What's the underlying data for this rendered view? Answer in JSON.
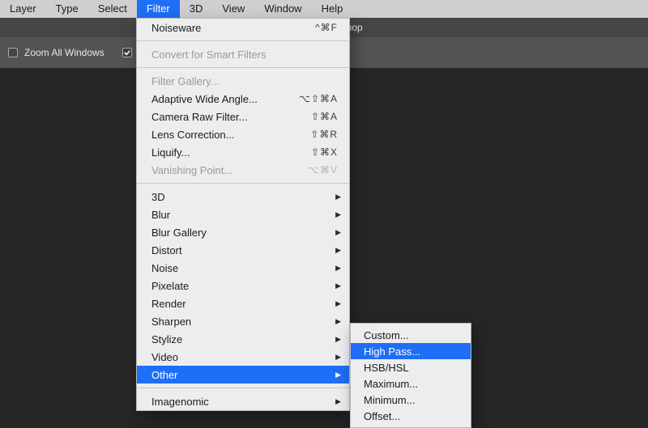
{
  "menubar": {
    "items": [
      "Layer",
      "Type",
      "Select",
      "Filter",
      "3D",
      "View",
      "Window",
      "Help"
    ],
    "activeIndex": 3
  },
  "appTitle": "Adobe Photoshop",
  "optionsBar": {
    "zoomAll": {
      "label": "Zoom All Windows",
      "checked": false
    },
    "scrubby": {
      "label": "Scrubby Zoom",
      "checked": true,
      "visibleLabel": "Scrubb"
    }
  },
  "filterMenu": {
    "groups": [
      [
        {
          "label": "Noiseware",
          "shortcut": "^⌘F",
          "disabled": false
        }
      ],
      [
        {
          "label": "Convert for Smart Filters",
          "shortcut": "",
          "disabled": true
        }
      ],
      [
        {
          "label": "Filter Gallery...",
          "shortcut": "",
          "disabled": true
        },
        {
          "label": "Adaptive Wide Angle...",
          "shortcut": "⌥⇧⌘A",
          "disabled": false
        },
        {
          "label": "Camera Raw Filter...",
          "shortcut": "⇧⌘A",
          "disabled": false
        },
        {
          "label": "Lens Correction...",
          "shortcut": "⇧⌘R",
          "disabled": false
        },
        {
          "label": "Liquify...",
          "shortcut": "⇧⌘X",
          "disabled": false
        },
        {
          "label": "Vanishing Point...",
          "shortcut": "⌥⌘V",
          "disabled": true
        }
      ],
      [
        {
          "label": "3D",
          "submenu": true
        },
        {
          "label": "Blur",
          "submenu": true
        },
        {
          "label": "Blur Gallery",
          "submenu": true
        },
        {
          "label": "Distort",
          "submenu": true
        },
        {
          "label": "Noise",
          "submenu": true
        },
        {
          "label": "Pixelate",
          "submenu": true
        },
        {
          "label": "Render",
          "submenu": true
        },
        {
          "label": "Sharpen",
          "submenu": true
        },
        {
          "label": "Stylize",
          "submenu": true
        },
        {
          "label": "Video",
          "submenu": true
        },
        {
          "label": "Other",
          "submenu": true,
          "highlight": true
        }
      ],
      [
        {
          "label": "Imagenomic",
          "submenu": true
        }
      ]
    ]
  },
  "otherSubmenu": {
    "items": [
      {
        "label": "Custom..."
      },
      {
        "label": "High Pass...",
        "highlight": true
      },
      {
        "label": "HSB/HSL"
      },
      {
        "label": "Maximum..."
      },
      {
        "label": "Minimum..."
      },
      {
        "label": "Offset..."
      }
    ]
  }
}
